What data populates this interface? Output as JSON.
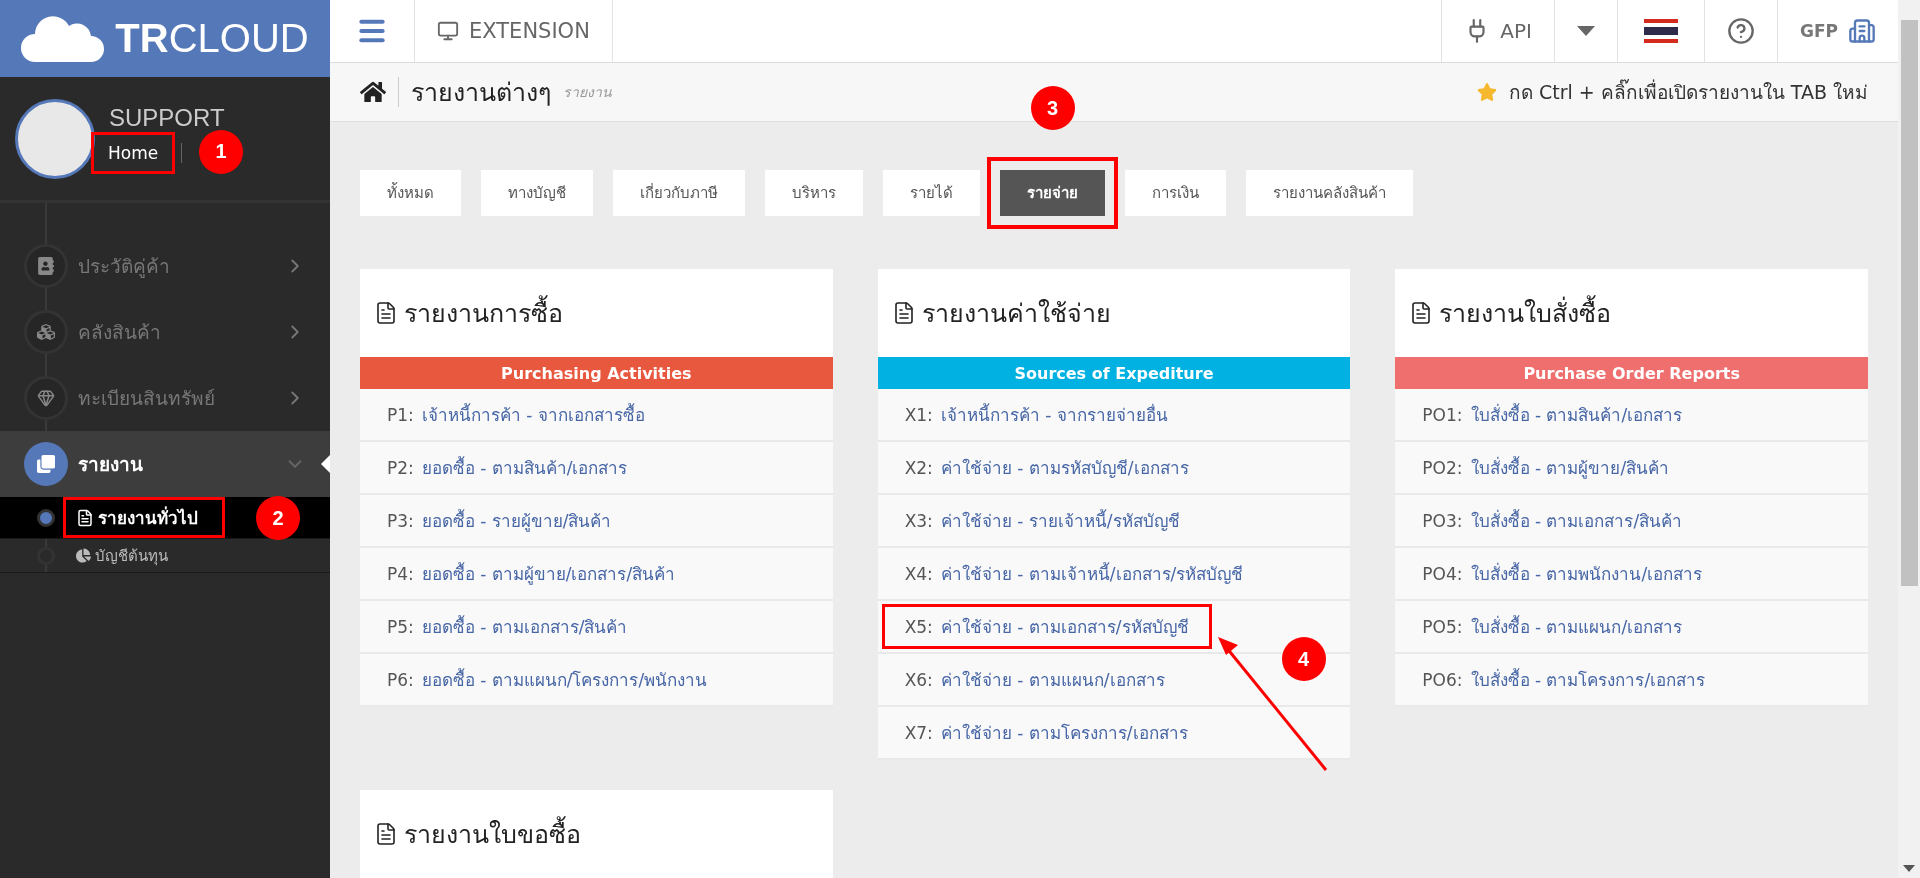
{
  "brand": {
    "bold": "TR",
    "light": "CLOUD"
  },
  "profile": {
    "name": "SUPPORT",
    "link": "Home",
    "highlighted": true,
    "marker": "1"
  },
  "sidebar": {
    "items": [
      {
        "label": "ประวัติคู่ค้า",
        "selected": false,
        "expanded": false
      },
      {
        "label": "คลังสินค้า",
        "selected": false,
        "expanded": false
      },
      {
        "label": "ทะเบียนสินทรัพย์",
        "selected": false,
        "expanded": false
      },
      {
        "label": "รายงาน",
        "selected": true,
        "expanded": true,
        "children": [
          {
            "label": "รายงานทั่วไป",
            "selected": true,
            "highlighted": true,
            "marker": "2"
          },
          {
            "label": "บัญชีต้นทุน",
            "selected": false,
            "highlighted": false
          }
        ]
      }
    ]
  },
  "topbar": {
    "extension": "EXTENSION",
    "api": "API",
    "user": "GFP"
  },
  "page_header": {
    "title": "รายงานต่างๆ",
    "subtitle": "รายงาน",
    "hint": "กด Ctrl + คลิ๊กเพื่อเปิดรายงานใน TAB ใหม่"
  },
  "tabs": [
    {
      "label": "ทั้งหมด",
      "selected": false,
      "highlighted": false
    },
    {
      "label": "ทางบัญชี",
      "selected": false,
      "highlighted": false
    },
    {
      "label": "เกี่ยวกับภาษี",
      "selected": false,
      "highlighted": false
    },
    {
      "label": "บริหาร",
      "selected": false,
      "highlighted": false
    },
    {
      "label": "รายได้",
      "selected": false,
      "highlighted": false
    },
    {
      "label": "รายจ่าย",
      "selected": true,
      "highlighted": true,
      "marker": "3"
    },
    {
      "label": "การเงิน",
      "selected": false,
      "highlighted": false
    },
    {
      "label": "รายงานคลังสินค้า",
      "selected": false,
      "highlighted": false
    }
  ],
  "cards": [
    {
      "title": "รายงานการซื้อ",
      "header": "Purchasing Activities",
      "color": "#e8583f",
      "rows": [
        {
          "code": "P1:",
          "label": "เจ้าหนี้การค้า - จากเอกสารซื้อ",
          "highlighted": false
        },
        {
          "code": "P2:",
          "label": "ยอดซื้อ - ตามสินค้า/เอกสาร",
          "highlighted": false
        },
        {
          "code": "P3:",
          "label": "ยอดซื้อ - รายผู้ขาย/สินค้า",
          "highlighted": false
        },
        {
          "code": "P4:",
          "label": "ยอดซื้อ - ตามผู้ขาย/เอกสาร/สินค้า",
          "highlighted": false
        },
        {
          "code": "P5:",
          "label": "ยอดซื้อ - ตามเอกสาร/สินค้า",
          "highlighted": false
        },
        {
          "code": "P6:",
          "label": "ยอดซื้อ - ตามแผนก/โครงการ/พนักงาน",
          "highlighted": false
        }
      ]
    },
    {
      "title": "รายงานค่าใช้จ่าย",
      "header": "Sources of Expediture",
      "color": "#00b1e1",
      "rows": [
        {
          "code": "X1:",
          "label": "เจ้าหนี้การค้า - จากรายจ่ายอื่น",
          "highlighted": false
        },
        {
          "code": "X2:",
          "label": "ค่าใช้จ่าย - ตามรหัสบัญชี/เอกสาร",
          "highlighted": false
        },
        {
          "code": "X3:",
          "label": "ค่าใช้จ่าย - รายเจ้าหนี้/รหัสบัญชี",
          "highlighted": false
        },
        {
          "code": "X4:",
          "label": "ค่าใช้จ่าย - ตามเจ้าหนี้/เอกสาร/รหัสบัญชี",
          "highlighted": false
        },
        {
          "code": "X5:",
          "label": "ค่าใช้จ่าย - ตามเอกสาร/รหัสบัญชี",
          "highlighted": true,
          "marker": "4"
        },
        {
          "code": "X6:",
          "label": "ค่าใช้จ่าย - ตามแผนก/เอกสาร",
          "highlighted": false
        },
        {
          "code": "X7:",
          "label": "ค่าใช้จ่าย - ตามโครงการ/เอกสาร",
          "highlighted": false
        }
      ]
    },
    {
      "title": "รายงานใบสั่งซื้อ",
      "header": "Purchase Order Reports",
      "color": "#ef6e6e",
      "rows": [
        {
          "code": "PO1:",
          "label": "ใบสั่งซื้อ - ตามสินค้า/เอกสาร",
          "highlighted": false
        },
        {
          "code": "PO2:",
          "label": "ใบสั่งซื้อ - ตามผู้ขาย/สินค้า",
          "highlighted": false
        },
        {
          "code": "PO3:",
          "label": "ใบสั่งซื้อ - ตามเอกสาร/สินค้า",
          "highlighted": false
        },
        {
          "code": "PO4:",
          "label": "ใบสั่งซื้อ - ตามพนักงาน/เอกสาร",
          "highlighted": false
        },
        {
          "code": "PO5:",
          "label": "ใบสั่งซื้อ - ตามแผนก/เอกสาร",
          "highlighted": false
        },
        {
          "code": "PO6:",
          "label": "ใบสั่งซื้อ - ตามโครงการ/เอกสาร",
          "highlighted": false
        }
      ]
    },
    {
      "title": "รายงานใบขอซื้อ"
    }
  ]
}
